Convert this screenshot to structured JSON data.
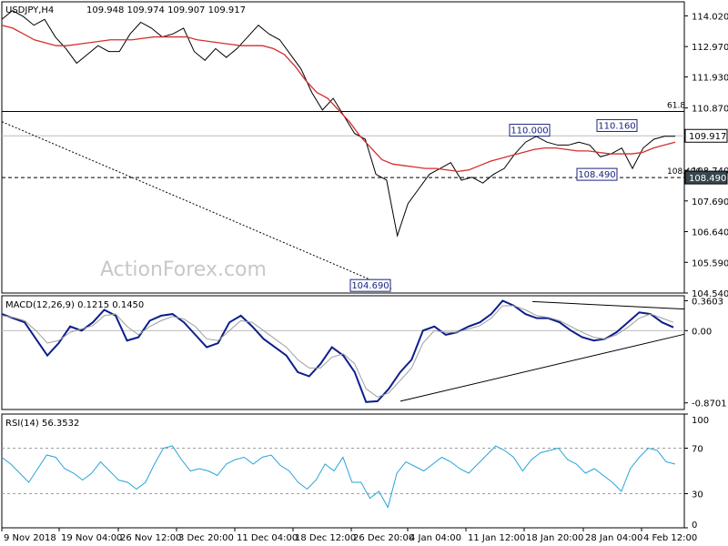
{
  "chart_data": [
    {
      "type": "line",
      "title": "USDJPY,H4",
      "ohlc": "109.948 109.974 109.907 109.917",
      "watermark": "ActionForex.com",
      "ylim": [
        104.54,
        114.5
      ],
      "y_ticks": [
        "114.020",
        "112.970",
        "111.930",
        "110.870",
        "109.917",
        "108.740",
        "108.490",
        "107.690",
        "106.640",
        "105.590",
        "104.540"
      ],
      "current_price": 109.917,
      "current_price_label": "109.917",
      "horizontal_levels": [
        {
          "value": 110.75,
          "label": "61.8",
          "style": "solid"
        },
        {
          "value": 109.917,
          "label": "",
          "style": "light"
        },
        {
          "value": 108.49,
          "label": "108.490",
          "style": "dashed"
        }
      ],
      "annotations": [
        {
          "text": "110.000",
          "x": "18 Jan",
          "y": 110.0
        },
        {
          "text": "110.160",
          "x": "1 Feb",
          "y": 110.16
        },
        {
          "text": "108.490",
          "x": "1 Feb",
          "y": 108.49
        },
        {
          "text": "104.690",
          "x": "3 Jan",
          "y": 104.69
        }
      ],
      "trendline": {
        "style": "dotted",
        "from": {
          "x": "9 Nov",
          "y": 110.4
        },
        "to": {
          "x": "3 Jan",
          "y": 104.69
        }
      },
      "series": [
        {
          "name": "price",
          "color": "#000000",
          "values": [
            113.9,
            114.2,
            114.0,
            113.7,
            113.9,
            113.3,
            112.9,
            112.4,
            112.7,
            113.0,
            112.8,
            112.8,
            113.4,
            113.8,
            113.6,
            113.3,
            113.4,
            113.6,
            112.8,
            112.5,
            112.9,
            112.6,
            112.9,
            113.3,
            113.7,
            113.4,
            113.2,
            112.7,
            112.2,
            111.4,
            110.8,
            111.2,
            110.6,
            110.0,
            109.8,
            108.6,
            108.4,
            106.5,
            107.6,
            108.1,
            108.6,
            108.8,
            109.0,
            108.4,
            108.5,
            108.3,
            108.6,
            108.8,
            109.3,
            109.7,
            109.9,
            109.7,
            109.6,
            109.6,
            109.7,
            109.6,
            109.2,
            109.3,
            109.5,
            108.8,
            109.5,
            109.8,
            109.9,
            109.9
          ]
        },
        {
          "name": "",
          "color": "#d32f2f",
          "values": [
            113.7,
            113.6,
            113.4,
            113.2,
            113.1,
            113.0,
            113.0,
            113.05,
            113.1,
            113.15,
            113.2,
            113.2,
            113.2,
            113.25,
            113.3,
            113.3,
            113.3,
            113.3,
            113.2,
            113.15,
            113.1,
            113.05,
            113.0,
            113.0,
            113.0,
            112.9,
            112.7,
            112.3,
            111.8,
            111.4,
            111.2,
            110.8,
            110.4,
            109.9,
            109.5,
            109.1,
            108.95,
            108.9,
            108.85,
            108.8,
            108.8,
            108.75,
            108.7,
            108.75,
            108.9,
            109.05,
            109.15,
            109.25,
            109.35,
            109.45,
            109.5,
            109.5,
            109.45,
            109.4,
            109.4,
            109.35,
            109.3,
            109.3,
            109.3,
            109.35,
            109.5,
            109.6,
            109.7
          ]
        }
      ]
    },
    {
      "type": "line",
      "title": "MACD(12,26,9) 0.1215 0.1450",
      "ylim": [
        -0.95,
        0.42
      ],
      "y_ticks": [
        "0.3603",
        "0.00",
        "-0.8701"
      ],
      "series": [
        {
          "name": "",
          "color": "#0b1f8c",
          "values": [
            0.2,
            0.15,
            0.1,
            -0.1,
            -0.3,
            -0.15,
            0.05,
            0.0,
            0.1,
            0.25,
            0.18,
            -0.12,
            -0.08,
            0.12,
            0.18,
            0.2,
            0.1,
            -0.05,
            -0.2,
            -0.15,
            0.1,
            0.18,
            0.05,
            -0.1,
            -0.2,
            -0.3,
            -0.5,
            -0.55,
            -0.4,
            -0.2,
            -0.3,
            -0.5,
            -0.86,
            -0.85,
            -0.7,
            -0.5,
            -0.35,
            0.0,
            0.05,
            -0.05,
            -0.02,
            0.05,
            0.1,
            0.2,
            0.36,
            0.3,
            0.2,
            0.15,
            0.15,
            0.1,
            0.0,
            -0.08,
            -0.12,
            -0.1,
            -0.02,
            0.1,
            0.22,
            0.2,
            0.1,
            0.04
          ]
        },
        {
          "name": "",
          "color": "#9e9e9e",
          "values": [
            0.18,
            0.16,
            0.12,
            0.0,
            -0.15,
            -0.12,
            -0.02,
            0.02,
            0.06,
            0.18,
            0.2,
            0.05,
            -0.05,
            0.05,
            0.12,
            0.17,
            0.14,
            0.05,
            -0.1,
            -0.12,
            0.0,
            0.12,
            0.1,
            0.0,
            -0.1,
            -0.2,
            -0.35,
            -0.45,
            -0.45,
            -0.32,
            -0.28,
            -0.4,
            -0.7,
            -0.8,
            -0.75,
            -0.6,
            -0.45,
            -0.15,
            0.0,
            -0.02,
            -0.02,
            0.02,
            0.06,
            0.15,
            0.3,
            0.3,
            0.25,
            0.18,
            0.16,
            0.12,
            0.05,
            -0.02,
            -0.08,
            -0.1,
            -0.05,
            0.04,
            0.15,
            0.2,
            0.15,
            0.1
          ]
        }
      ],
      "support_line": {
        "from": {
          "x": "3 Jan",
          "y": -0.85
        },
        "to": {
          "x": "end",
          "y": 0.0
        }
      },
      "resistance_line": {
        "from": {
          "x": "18 Jan",
          "y": 0.35
        },
        "to": {
          "x": "end",
          "y": 0.26
        }
      }
    },
    {
      "type": "line",
      "title": "RSI(14) 56.3532",
      "ylim": [
        0,
        100
      ],
      "y_ticks": [
        "100",
        "70",
        "30",
        "0"
      ],
      "levels": [
        70,
        30
      ],
      "series": [
        {
          "name": "",
          "color": "#29a3d9",
          "values": [
            62,
            56,
            48,
            40,
            52,
            64,
            62,
            52,
            48,
            42,
            48,
            58,
            50,
            42,
            40,
            34,
            40,
            56,
            70,
            72,
            60,
            50,
            52,
            50,
            46,
            56,
            60,
            62,
            56,
            62,
            64,
            55,
            50,
            40,
            34,
            42,
            56,
            50,
            62,
            40,
            40,
            26,
            32,
            18,
            48,
            58,
            54,
            50,
            56,
            62,
            58,
            52,
            48,
            56,
            64,
            72,
            68,
            62,
            50,
            60,
            66,
            68,
            70,
            60,
            56,
            48,
            52,
            46,
            40,
            32,
            52,
            62,
            70,
            68,
            58,
            56
          ]
        }
      ]
    }
  ],
  "x_ticks": [
    "9 Nov 2018",
    "19 Nov 04:00",
    "26 Nov 12:00",
    "3 Dec 20:00",
    "11 Dec 04:00",
    "18 Dec 12:00",
    "26 Dec 20:00",
    "4 Jan 04:00",
    "11 Jan 12:00",
    "18 Jan 20:00",
    "28 Jan 04:00",
    "4 Feb 12:00"
  ]
}
